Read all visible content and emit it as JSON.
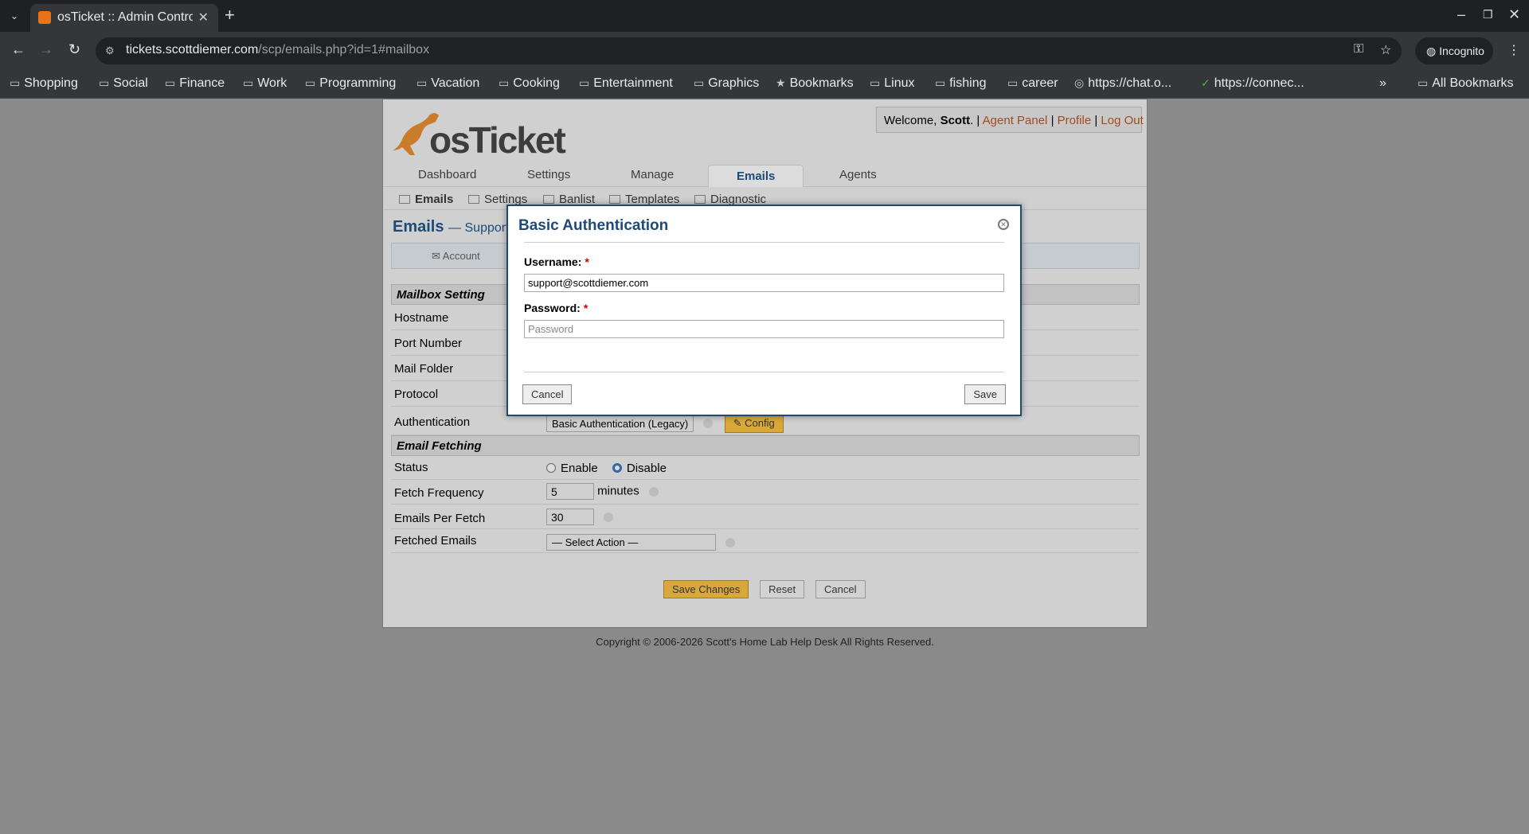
{
  "browser": {
    "tab_title": "osTicket :: Admin Control Panel",
    "url_host": "tickets.scottdiemer.com",
    "url_path": "/scp/emails.php?id=1#mailbox",
    "incognito_label": "Incognito",
    "bookmarks": [
      "Shopping",
      "Social",
      "Finance",
      "Work",
      "Programming",
      "Vacation",
      "Cooking",
      "Entertainment",
      "Graphics",
      "Bookmarks",
      "Linux",
      "fishing",
      "career",
      "https://chat.o...",
      "https://connec..."
    ],
    "all_bookmarks": "All Bookmarks"
  },
  "header": {
    "logo_text": "osTicket",
    "welcome_prefix": "Welcome, ",
    "user": "Scott",
    "welcome_suffix": ". |",
    "agent_panel": "Agent Panel",
    "profile": "Profile",
    "logout": "Log Out",
    "sep": "|"
  },
  "nav": {
    "tabs": [
      "Dashboard",
      "Settings",
      "Manage",
      "Emails",
      "Agents"
    ],
    "subnav": [
      "Emails",
      "Settings",
      "Banlist",
      "Templates",
      "Diagnostic"
    ]
  },
  "main": {
    "title": "Emails",
    "subtitle": "— Support",
    "tab_account": "Account",
    "mailbox_section": "Mailbox Setting",
    "rows": {
      "hostname": "Hostname",
      "port": "Port Number",
      "folder": "Mail Folder",
      "protocol": "Protocol",
      "auth": "Authentication",
      "auth_value": "Basic Authentication (Legacy)",
      "config_button": "Config"
    },
    "fetch_section": "Email Fetching",
    "status_label": "Status",
    "enable": "Enable",
    "disable": "Disable",
    "frequency_label": "Fetch Frequency",
    "frequency_value": "5",
    "minutes": "minutes",
    "per_fetch_label": "Emails Per Fetch",
    "per_fetch_value": "30",
    "fetched_label": "Fetched Emails",
    "fetched_value": "— Select Action —",
    "save_changes": "Save Changes",
    "reset": "Reset",
    "cancel": "Cancel"
  },
  "footer": "Copyright © 2006-2026 Scott's Home Lab Help Desk All Rights Reserved.",
  "modal": {
    "title": "Basic Authentication",
    "username_label": "Username:",
    "username_value": "support@scottdiemer.com",
    "password_label": "Password:",
    "password_placeholder": "Password",
    "required": "*",
    "cancel": "Cancel",
    "save": "Save"
  }
}
